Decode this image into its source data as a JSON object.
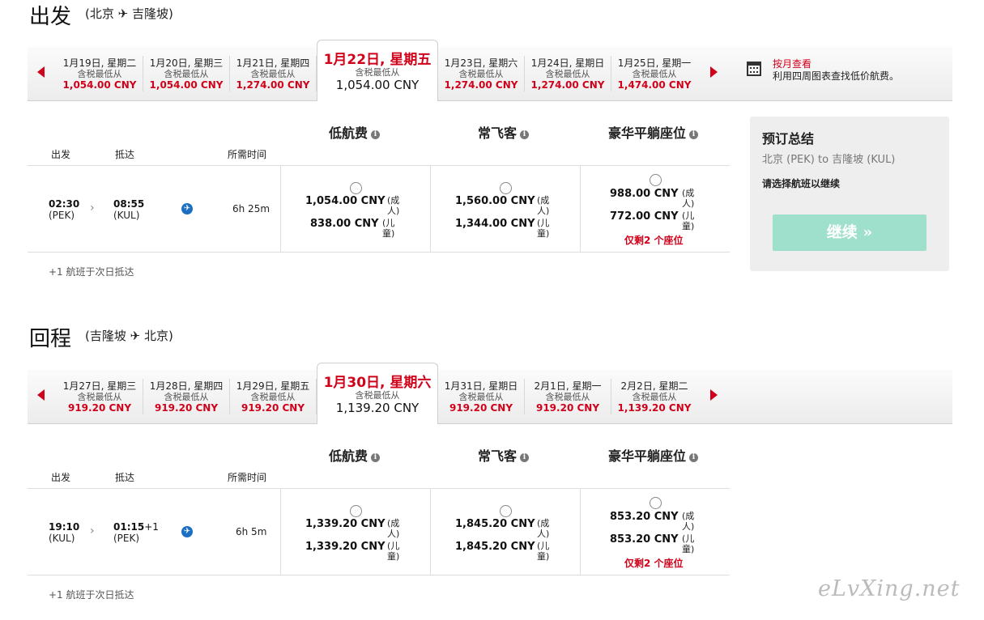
{
  "outbound": {
    "title": "出发",
    "route": "(北京 ✈ 吉隆坡)",
    "dates": [
      {
        "date": "1月19日, 星期二",
        "sub": "含税最低从",
        "price": "1,054.00 CNY"
      },
      {
        "date": "1月20日, 星期三",
        "sub": "含税最低从",
        "price": "1,054.00 CNY"
      },
      {
        "date": "1月21日, 星期四",
        "sub": "含税最低从",
        "price": "1,274.00 CNY"
      },
      {
        "date": "1月22日, 星期五",
        "sub": "含税最低从",
        "price": "1,054.00 CNY"
      },
      {
        "date": "1月23日, 星期六",
        "sub": "含税最低从",
        "price": "1,274.00 CNY"
      },
      {
        "date": "1月24日, 星期日",
        "sub": "含税最低从",
        "price": "1,274.00 CNY"
      },
      {
        "date": "1月25日, 星期一",
        "sub": "含税最低从",
        "price": "1,474.00 CNY"
      }
    ],
    "calendar": {
      "link": "按月查看",
      "text": "利用四周图表查找低价航费。"
    },
    "fare_headers": [
      "低航费",
      "常飞客",
      "豪华平躺座位"
    ],
    "col_headers": {
      "depart": "出发",
      "arrive": "抵达",
      "duration": "所需时间"
    },
    "flight": {
      "dep_time": "02:30",
      "dep_code": "(PEK)",
      "arr_time": "08:55",
      "arr_suffix": "",
      "arr_code": "(KUL)",
      "duration": "6h 25m",
      "fares": [
        {
          "adult": "1,054.00 CNY",
          "child": "838.00 CNY",
          "warn": ""
        },
        {
          "adult": "1,560.00 CNY",
          "child": "1,344.00 CNY",
          "warn": ""
        },
        {
          "adult": "988.00 CNY",
          "child": "772.00 CNY",
          "warn": "仅剩2 个座位"
        }
      ]
    },
    "note": "+1 航班于次日抵达"
  },
  "return": {
    "title": "回程",
    "route": "(吉隆坡 ✈ 北京)",
    "dates": [
      {
        "date": "1月27日, 星期三",
        "sub": "含税最低从",
        "price": "919.20 CNY"
      },
      {
        "date": "1月28日, 星期四",
        "sub": "含税最低从",
        "price": "919.20 CNY"
      },
      {
        "date": "1月29日, 星期五",
        "sub": "含税最低从",
        "price": "919.20 CNY"
      },
      {
        "date": "1月30日, 星期六",
        "sub": "含税最低从",
        "price": "1,139.20 CNY"
      },
      {
        "date": "1月31日, 星期日",
        "sub": "含税最低从",
        "price": "919.20 CNY"
      },
      {
        "date": "2月1日, 星期一",
        "sub": "含税最低从",
        "price": "919.20 CNY"
      },
      {
        "date": "2月2日, 星期二",
        "sub": "含税最低从",
        "price": "1,139.20 CNY"
      }
    ],
    "fare_headers": [
      "低航费",
      "常飞客",
      "豪华平躺座位"
    ],
    "col_headers": {
      "depart": "出发",
      "arrive": "抵达",
      "duration": "所需时间"
    },
    "flight": {
      "dep_time": "19:10",
      "dep_code": "(KUL)",
      "arr_time": "01:15",
      "arr_suffix": "+1",
      "arr_code": "(PEK)",
      "duration": "6h 5m",
      "fares": [
        {
          "adult": "1,339.20 CNY",
          "child": "1,339.20 CNY",
          "warn": ""
        },
        {
          "adult": "1,845.20 CNY",
          "child": "1,845.20 CNY",
          "warn": ""
        },
        {
          "adult": "853.20 CNY",
          "child": "853.20 CNY",
          "warn": "仅剩2 个座位"
        }
      ]
    },
    "note": "+1 航班于次日抵达"
  },
  "labels": {
    "adult": "(成人)",
    "child": "(儿童)",
    "info": "i",
    "chev": "›",
    "plane": "✈"
  },
  "summary": {
    "title": "预订总结",
    "route": "北京 (PEK) to 吉隆坡 (KUL)",
    "msg": "请选择航班以继续",
    "button": "继续 »"
  },
  "watermark": "eLvXing.net",
  "colors": {
    "accent": "#d0021b",
    "button": "#9ee0cb",
    "plane_icon": "#1b6ec2"
  }
}
